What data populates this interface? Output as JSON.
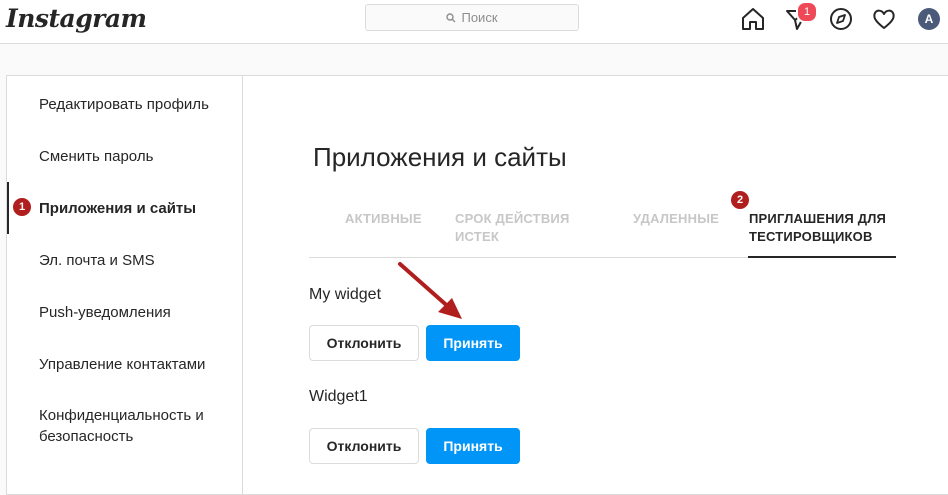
{
  "header": {
    "logo": "Instagram",
    "search_placeholder": "Поиск",
    "notification_count": "1",
    "avatar_initial": "A"
  },
  "sidebar": {
    "items": [
      {
        "label": "Редактировать профиль"
      },
      {
        "label": "Сменить пароль"
      },
      {
        "label": "Приложения и сайты"
      },
      {
        "label": "Эл. почта и SMS"
      },
      {
        "label": "Push-уведомления"
      },
      {
        "label": "Управление контактами"
      },
      {
        "label": "Конфиденциальность и безопасность"
      }
    ],
    "active_index": 2,
    "step_badge": "1"
  },
  "main": {
    "title": "Приложения и сайты",
    "tabs": [
      {
        "label": "АКТИВНЫЕ"
      },
      {
        "label": "СРОК ДЕЙСТВИЯ ИСТЕК"
      },
      {
        "label": "УДАЛЕННЫЕ"
      },
      {
        "label": "ПРИГЛАШЕНИЯ ДЛЯ ТЕСТИРОВЩИКОВ"
      }
    ],
    "active_tab": 3,
    "tab_step_badge": "2",
    "widgets": [
      {
        "name": "My widget",
        "decline_label": "Отклонить",
        "accept_label": "Принять"
      },
      {
        "name": "Widget1",
        "decline_label": "Отклонить",
        "accept_label": "Принять"
      }
    ]
  },
  "colors": {
    "accent": "#0095f6",
    "badge_red": "#ed4956",
    "annotation_red": "#b01e1e"
  }
}
